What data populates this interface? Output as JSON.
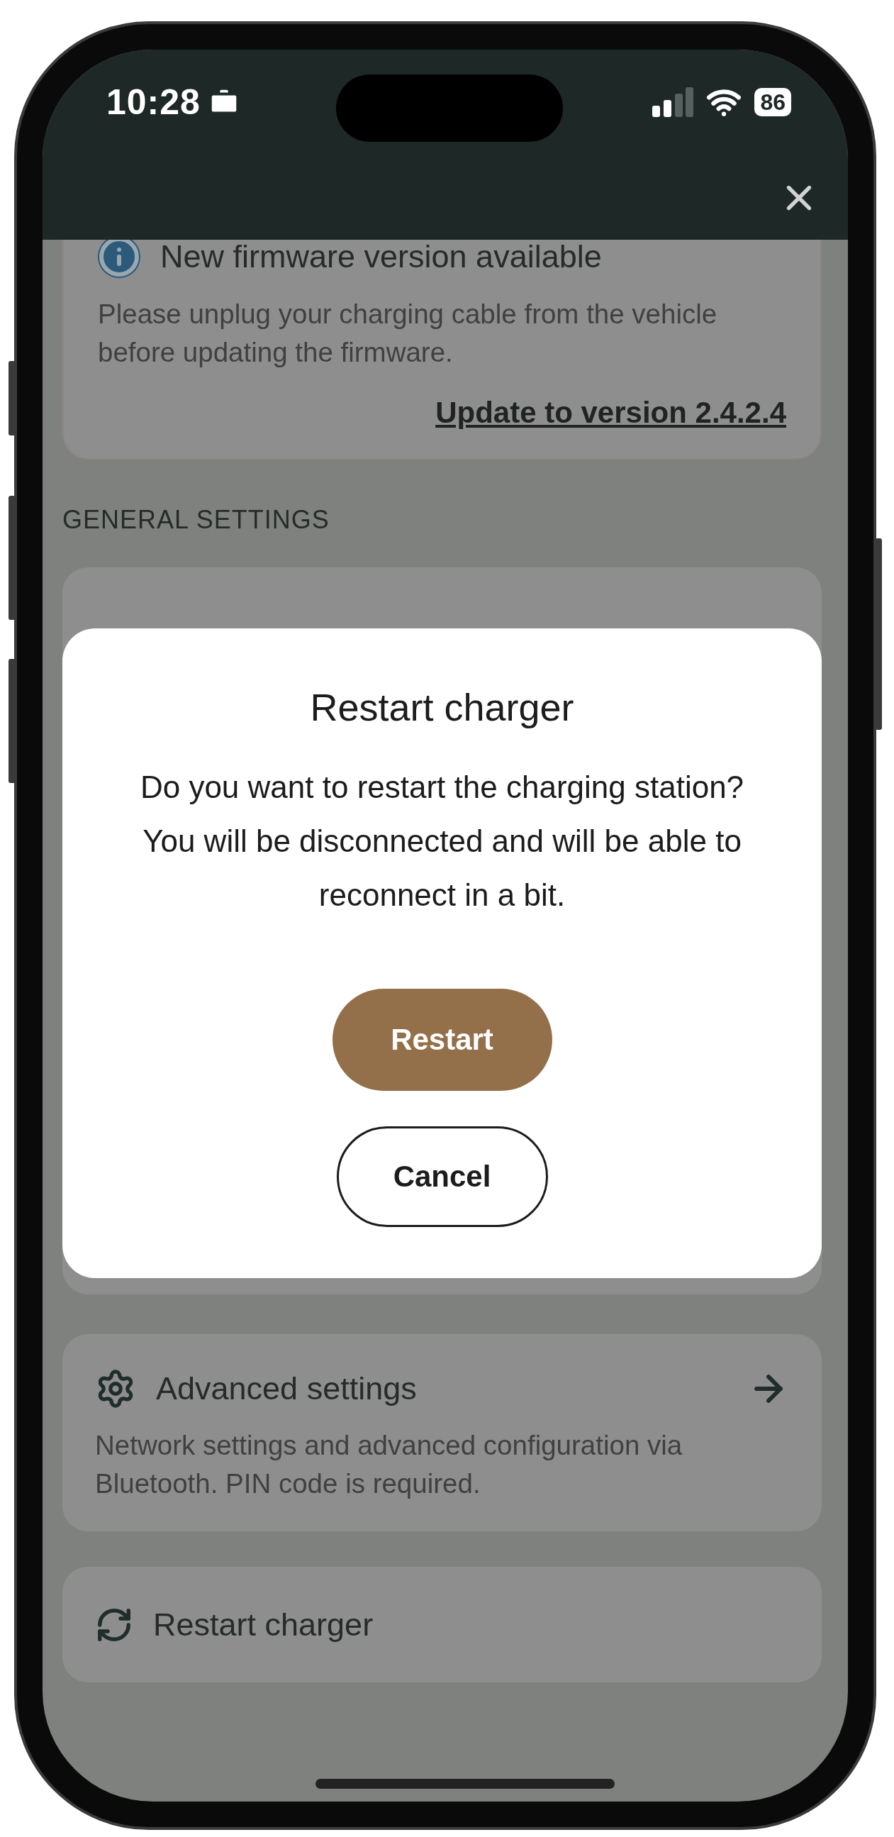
{
  "status_bar": {
    "time": "10:28",
    "battery": "86"
  },
  "firmware_notice": {
    "title": "New firmware version available",
    "message": "Please unplug your charging cable from the vehicle before updating the firmware.",
    "link": "Update to version 2.4.2.4"
  },
  "section_title": "GENERAL SETTINGS",
  "settings": [
    {
      "kind": "link",
      "title": "Advanced settings",
      "description": "Network settings and advanced configuration via Bluetooth. PIN code is required."
    },
    {
      "kind": "action",
      "title": "Restart charger"
    }
  ],
  "dialog": {
    "title": "Restart charger",
    "message": "Do you want to restart the charging station? You will be disconnected and will be able to reconnect in a bit.",
    "buttons": [
      {
        "label": "Restart",
        "kind": "primary"
      },
      {
        "label": "Cancel",
        "kind": "secondary"
      }
    ]
  }
}
